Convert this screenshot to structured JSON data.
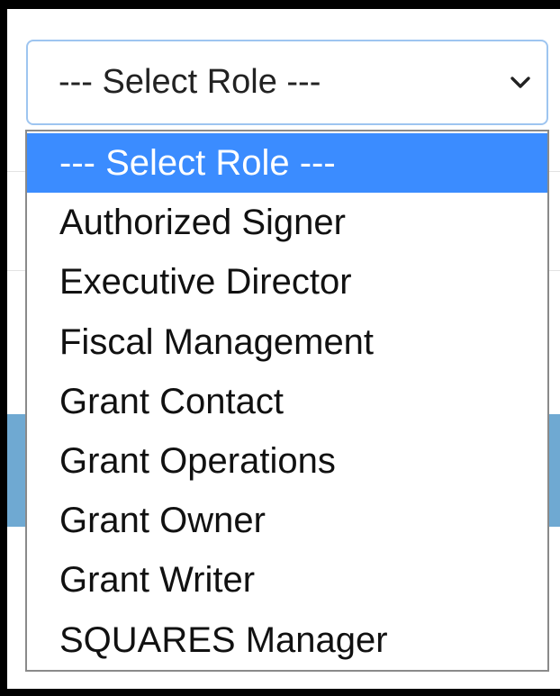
{
  "select": {
    "value": "--- Select Role ---",
    "expand_icon": "chevron-down-icon"
  },
  "options": [
    {
      "label": "--- Select Role ---",
      "selected": true
    },
    {
      "label": "Authorized Signer",
      "selected": false
    },
    {
      "label": "Executive Director",
      "selected": false
    },
    {
      "label": "Fiscal Management",
      "selected": false
    },
    {
      "label": "Grant Contact",
      "selected": false
    },
    {
      "label": "Grant Operations",
      "selected": false
    },
    {
      "label": "Grant Owner",
      "selected": false
    },
    {
      "label": "Grant Writer",
      "selected": false
    },
    {
      "label": "SQUARES Manager",
      "selected": false
    }
  ],
  "colors": {
    "highlight": "#3b8cff",
    "focus_border": "#9ec5f0",
    "background_band": "#6fa9d2"
  }
}
